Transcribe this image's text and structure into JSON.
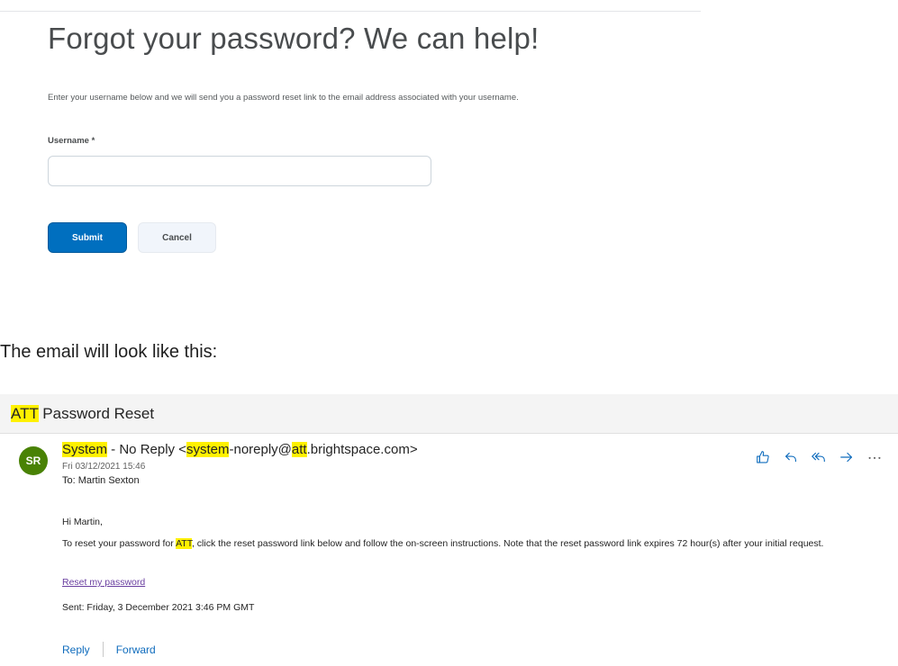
{
  "form": {
    "title": "Forgot your password? We can help!",
    "instructions": "Enter your username below and we will send you a password reset link to the email address associated with your username.",
    "username_label": "Username *",
    "username_value": "",
    "submit_label": "Submit",
    "cancel_label": "Cancel"
  },
  "intro_text": "The email will look like this:",
  "email": {
    "subject_highlight": "ATT",
    "subject_rest": " Password Reset",
    "avatar_initials": "SR",
    "avatar_color": "#498205",
    "sender_name": "System",
    "sender_mid": " - No Reply <",
    "sender_local": "system",
    "sender_local_rest": "-noreply@",
    "sender_domain_highlight": "att",
    "sender_domain_rest": ".brightspace.com>",
    "date": "Fri 03/12/2021 15:46",
    "to": "To:  Martin Sexton",
    "greeting": "Hi Martin,",
    "body_before": "To reset your password for ",
    "body_highlight": "ATT",
    "body_after": ", click the reset password link below and follow the on-screen instructions. Note that the reset password link expires 72 hour(s) after your initial request.",
    "reset_link": "Reset my password",
    "sent": "Sent: Friday, 3 December 2021 3:46 PM GMT",
    "reply_label": "Reply",
    "forward_label": "Forward",
    "actions": [
      "like-icon",
      "reply-icon",
      "reply-all-icon",
      "forward-icon",
      "more-icon"
    ]
  },
  "colors": {
    "primary": "#006fbf",
    "highlight": "#fff100",
    "link": "#6a3fa0",
    "outlook_blue": "#0f6cbd"
  }
}
